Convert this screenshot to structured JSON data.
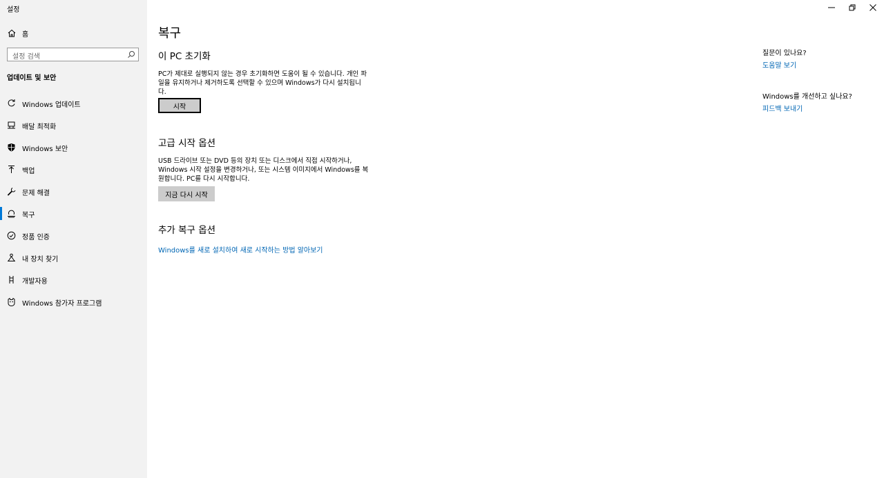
{
  "window": {
    "title": "설정",
    "controls": {
      "minimize": "minimize-icon",
      "restore": "restore-icon",
      "close": "close-icon"
    }
  },
  "sidebar": {
    "home_label": "홈",
    "search_placeholder": "설정 검색",
    "section_title": "업데이트 및 보안",
    "items": [
      {
        "label": "Windows 업데이트",
        "icon": "refresh-icon"
      },
      {
        "label": "배달 최적화",
        "icon": "delivery-icon"
      },
      {
        "label": "Windows 보안",
        "icon": "shield-icon"
      },
      {
        "label": "백업",
        "icon": "backup-icon"
      },
      {
        "label": "문제 해결",
        "icon": "wrench-icon"
      },
      {
        "label": "복구",
        "icon": "recovery-icon",
        "selected": true
      },
      {
        "label": "정품 인증",
        "icon": "check-circle-icon"
      },
      {
        "label": "내 장치 찾기",
        "icon": "find-device-icon"
      },
      {
        "label": "개발자용",
        "icon": "developer-icon"
      },
      {
        "label": "Windows 참가자 프로그램",
        "icon": "insider-icon"
      }
    ],
    "accent": "#0078d7"
  },
  "main": {
    "title": "복구",
    "reset": {
      "heading": "이 PC 초기화",
      "description": "PC가 제대로 실행되지 않는 경우 초기화하면 도움이 될 수 있습니다. 개인 파일을 유지하거나 제거하도록 선택할 수 있으며 Windows가 다시 설치됩니다.",
      "button": "시작"
    },
    "advanced": {
      "heading": "고급 시작 옵션",
      "description": "USB 드라이브 또는 DVD 등의 장치 또는 디스크에서 직접 시작하거나, Windows 시작 설정을 변경하거나, 또는 시스템 이미지에서 Windows를 복원합니다. PC를 다시 시작합니다.",
      "button": "지금 다시 시작"
    },
    "more": {
      "heading": "추가 복구 옵션",
      "link": "Windows를 새로 설치하여 새로 시작하는 방법 알아보기"
    }
  },
  "aside": {
    "question1": "질문이 있나요?",
    "link1": "도움말 보기",
    "question2": "Windows를 개선하고 싶나요?",
    "link2": "피드백 보내기"
  },
  "colors": {
    "link": "#0066b4",
    "sidebar_bg": "#f2f2f2",
    "button_bg": "#cccccc"
  }
}
